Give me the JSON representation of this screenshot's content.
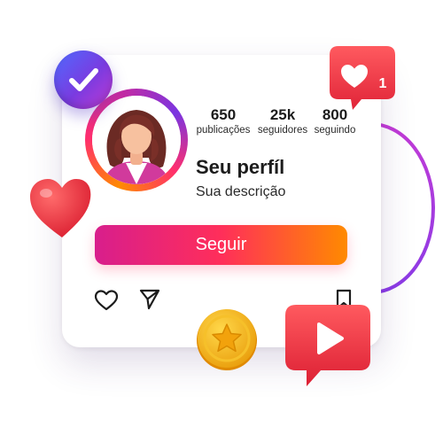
{
  "profile": {
    "name": "Seu perfíl",
    "description": "Sua descrição",
    "stats": [
      {
        "value": "650",
        "label": "publicações"
      },
      {
        "value": "25k",
        "label": "seguidores"
      },
      {
        "value": "800",
        "label": "seguindo"
      }
    ],
    "follow_label": "Seguir"
  },
  "notification": {
    "count": "1"
  },
  "colors": {
    "gradient_start": "#d81e8c",
    "gradient_mid": "#ff2e5a",
    "gradient_end": "#ff8a00",
    "verified_blue": "#4f6bff",
    "heart_red": "#f0323f",
    "coin_gold": "#f5b418"
  },
  "icons": {
    "verified": "check-badge-icon",
    "notification": "heart-notification-icon",
    "like": "heart-outline-icon",
    "share": "send-icon",
    "save": "bookmark-icon",
    "play": "play-icon",
    "coin": "star-coin-icon"
  }
}
